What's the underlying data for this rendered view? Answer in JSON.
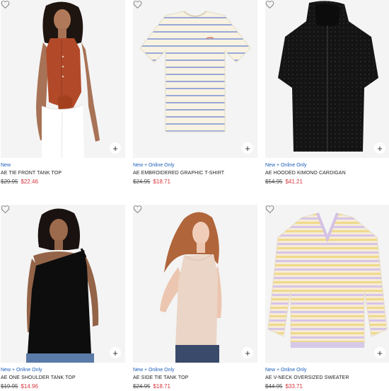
{
  "colors": {
    "badge": "#1a5eb8",
    "sale_price": "#d6373e",
    "image_bg": "#f3f3f3"
  },
  "icons": {
    "favorite": "heart-outline",
    "quick_add": "+"
  },
  "products": [
    {
      "badge": "New",
      "name": "AE TIE FRONT TANK TOP",
      "original_price": "$29.95",
      "sale_price": "$22.46"
    },
    {
      "badge": "New + Online Only",
      "name": "AE EMBROIDERED GRAPHIC T-SHIRT",
      "original_price": "$24.95",
      "sale_price": "$18.71"
    },
    {
      "badge": "New + Online Only",
      "name": "AE HOODED KIMONO CARDIGAN",
      "original_price": "$54.95",
      "sale_price": "$41.21"
    },
    {
      "badge": "New + Online Only",
      "name": "AE ONE SHOULDER TANK TOP",
      "original_price": "$19.95",
      "sale_price": "$14.96"
    },
    {
      "badge": "New + Online Only",
      "name": "AE SIDE TIE TANK TOP",
      "original_price": "$24.95",
      "sale_price": "$18.71"
    },
    {
      "badge": "New + Online Only",
      "name": "AE V-NECK OVERSIZED SWEATER",
      "original_price": "$44.95",
      "sale_price": "$33.71"
    }
  ]
}
